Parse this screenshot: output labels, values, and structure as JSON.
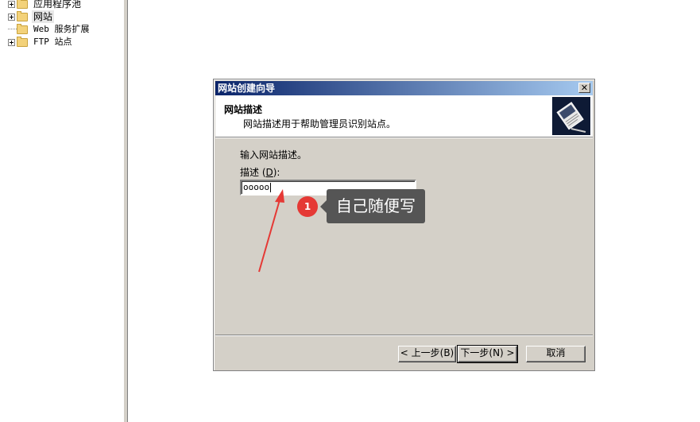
{
  "tree": {
    "items": [
      {
        "label": "应用程序池",
        "expandable": true,
        "selected": false
      },
      {
        "label": "网站",
        "expandable": true,
        "selected": true
      },
      {
        "label": "Web 服务扩展",
        "expandable": false,
        "selected": false
      },
      {
        "label": "FTP 站点",
        "expandable": true,
        "selected": false
      }
    ]
  },
  "dialog": {
    "title": "网站创建向导",
    "close_glyph": "✕",
    "header_title": "网站描述",
    "header_subtitle": "网站描述用于帮助管理员识别站点。",
    "icon": "wizard-book-icon",
    "prompt": "输入网站描述。",
    "desc_label_prefix": "描述 (",
    "desc_label_accel": "D",
    "desc_label_suffix": "):",
    "desc_value": "ooooo",
    "back_label": "< 上一步(B)",
    "next_label": "下一步(N) >",
    "cancel_label": "取消"
  },
  "annotation": {
    "badge": "1",
    "tooltip": "自己随便写",
    "colors": {
      "badge": "#e53935",
      "arrow": "#e53935",
      "tooltip_bg": "#555555"
    }
  }
}
